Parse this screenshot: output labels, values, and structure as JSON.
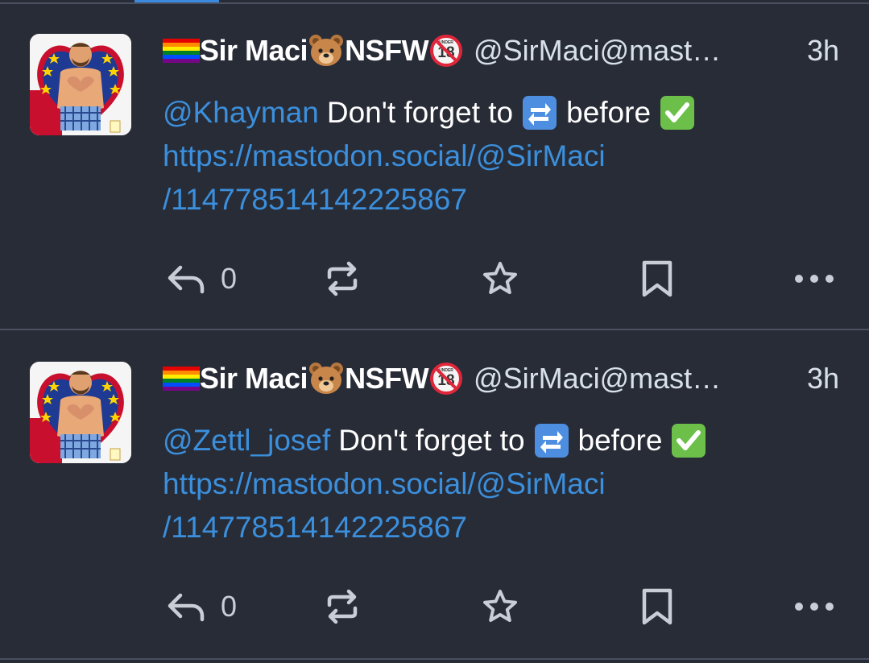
{
  "posts": [
    {
      "display_name": "Sir Maci",
      "display_name_suffix": "NSFW",
      "handle": "@SirMaci@mast…",
      "time": "3h",
      "mention": "@Khayman",
      "text_before": "Don't forget to",
      "text_after": "before",
      "link_line1": "https://mastodon.social/@SirMaci",
      "link_line2": "/114778514142225867",
      "reply_count": "0",
      "icons": {
        "name_prefix": "rainbow-flag-icon",
        "name_mid": "bear-face-icon",
        "name_suffix": "no-under-18-icon",
        "content_mid": "arrows-counterclockwise-icon",
        "content_end": "check-mark-button-icon"
      }
    },
    {
      "display_name": "Sir Maci",
      "display_name_suffix": "NSFW",
      "handle": "@SirMaci@mast…",
      "time": "3h",
      "mention": "@Zettl_josef",
      "text_before": "Don't forget to",
      "text_after": "before",
      "link_line1": "https://mastodon.social/@SirMaci",
      "link_line2": "/114778514142225867",
      "reply_count": "0",
      "icons": {
        "name_prefix": "rainbow-flag-icon",
        "name_mid": "bear-face-icon",
        "name_suffix": "no-under-18-icon",
        "content_mid": "arrows-counterclockwise-icon",
        "content_end": "check-mark-button-icon"
      }
    }
  ],
  "action_icons": [
    "reply-icon",
    "boost-icon",
    "favourite-icon",
    "bookmark-icon",
    "more-icon"
  ],
  "colors": {
    "background": "#282c37",
    "divider": "#4a5060",
    "link": "#3b8fdc",
    "secondary_text": "#d9e1e8",
    "icon": "#c8cdd6",
    "tab_indicator": "#3c8ae0"
  }
}
